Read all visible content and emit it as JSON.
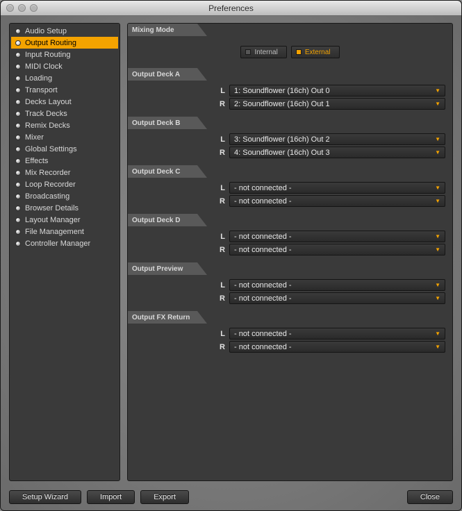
{
  "window": {
    "title": "Preferences"
  },
  "sidebar": {
    "selected_index": 1,
    "items": [
      {
        "label": "Audio Setup"
      },
      {
        "label": "Output Routing"
      },
      {
        "label": "Input Routing"
      },
      {
        "label": "MIDI Clock"
      },
      {
        "label": "Loading"
      },
      {
        "label": "Transport"
      },
      {
        "label": "Decks Layout"
      },
      {
        "label": "Track Decks"
      },
      {
        "label": "Remix Decks"
      },
      {
        "label": "Mixer"
      },
      {
        "label": "Global Settings"
      },
      {
        "label": "Effects"
      },
      {
        "label": "Mix Recorder"
      },
      {
        "label": "Loop Recorder"
      },
      {
        "label": "Broadcasting"
      },
      {
        "label": "Browser Details"
      },
      {
        "label": "Layout Manager"
      },
      {
        "label": "File Management"
      },
      {
        "label": "Controller Manager"
      }
    ]
  },
  "mixing_mode": {
    "heading": "Mixing Mode",
    "internal_label": "Internal",
    "external_label": "External",
    "active": "external"
  },
  "outputs": [
    {
      "heading": "Output Deck A",
      "rows": [
        {
          "label": "L",
          "value": "1: Soundflower (16ch) Out 0"
        },
        {
          "label": "R",
          "value": "2: Soundflower (16ch) Out 1"
        }
      ]
    },
    {
      "heading": "Output Deck B",
      "rows": [
        {
          "label": "L",
          "value": "3: Soundflower (16ch) Out 2"
        },
        {
          "label": "R",
          "value": "4: Soundflower (16ch) Out 3"
        }
      ]
    },
    {
      "heading": "Output Deck C",
      "rows": [
        {
          "label": "L",
          "value": "- not connected -"
        },
        {
          "label": "R",
          "value": "- not connected -"
        }
      ]
    },
    {
      "heading": "Output Deck D",
      "rows": [
        {
          "label": "L",
          "value": "- not connected -"
        },
        {
          "label": "R",
          "value": "- not connected -"
        }
      ]
    },
    {
      "heading": "Output Preview",
      "rows": [
        {
          "label": "L",
          "value": "- not connected -"
        },
        {
          "label": "R",
          "value": "- not connected -"
        }
      ]
    },
    {
      "heading": "Output FX Return",
      "rows": [
        {
          "label": "L",
          "value": "- not connected -"
        },
        {
          "label": "R",
          "value": "- not connected -"
        }
      ]
    }
  ],
  "footer": {
    "setup_wizard": "Setup Wizard",
    "import": "Import",
    "export": "Export",
    "close": "Close"
  }
}
